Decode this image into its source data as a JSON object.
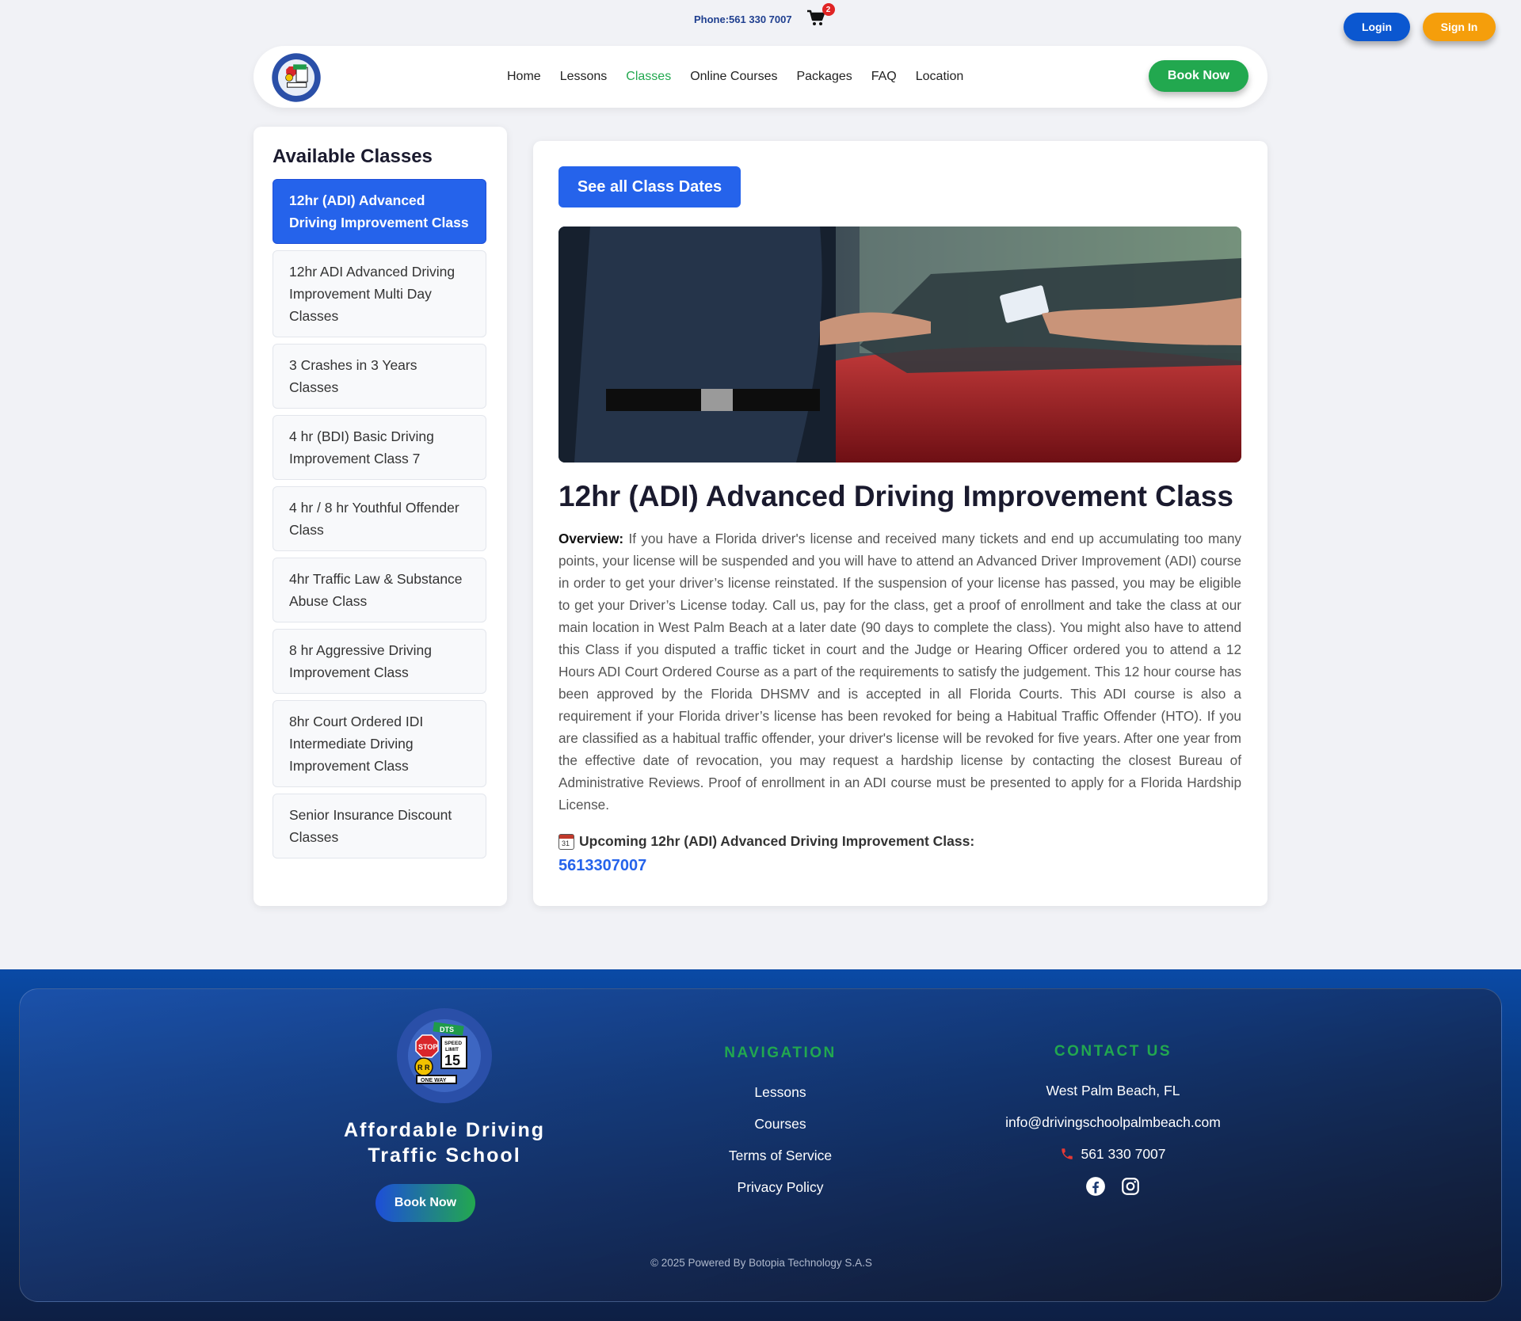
{
  "topbar": {
    "phone": "Phone:561 330 7007",
    "cart_count": "2",
    "login_label": "Login",
    "signin_label": "Sign In"
  },
  "nav": {
    "items": [
      {
        "label": "Home",
        "active": false
      },
      {
        "label": "Lessons",
        "active": false
      },
      {
        "label": "Classes",
        "active": true
      },
      {
        "label": "Online Courses",
        "active": false
      },
      {
        "label": "Packages",
        "active": false
      },
      {
        "label": "FAQ",
        "active": false
      },
      {
        "label": "Location",
        "active": false
      }
    ],
    "book_now": "Book Now"
  },
  "sidebar": {
    "title": "Available Classes",
    "items": [
      "12hr (ADI) Advanced Driving Improvement Class",
      "12hr ADI Advanced Driving Improvement Multi Day Classes",
      "3 Crashes in 3 Years Classes",
      "4 hr (BDI) Basic Driving Improvement Class 7",
      "4 hr / 8 hr Youthful Offender Class",
      "4hr Traffic Law & Substance Abuse Class",
      "8 hr Aggressive Driving Improvement Class",
      "8hr Court Ordered IDI Intermediate Driving Improvement Class",
      "Senior Insurance Discount Classes"
    ],
    "active_index": 0
  },
  "main": {
    "see_dates": "See all Class Dates",
    "title": "12hr (ADI) Advanced Driving Improvement Class",
    "overview_label": "Overview:",
    "overview_text": " If you have a Florida driver's license and received many tickets and end up accumulating too many points, your license will be suspended and you will have to attend an Advanced Driver Improvement (ADI) course in order to get your driver’s license reinstated. If the suspension of your license has passed, you may be eligible to get your Driver’s License today. Call us, pay for the class, get a proof of enrollment and take the class at our main location in West Palm Beach at a later date (90 days to complete the class). You might also have to attend this Class if you disputed a traffic ticket in court and the Judge or Hearing Officer ordered you to attend a 12 Hours ADI Court Ordered Course as a part of the requirements to satisfy the judgement. This 12 hour course has been approved by the Florida DHSMV and is accepted in all Florida Courts. This ADI course is also a requirement if your Florida driver’s license has been revoked for being a Habitual Traffic Offender (HTO). If you are classified as a habitual traffic offender, your driver's license will be revoked for five years. After one year from the effective date of revocation, you may request a hardship license by contacting the closest Bureau of Administrative Reviews. Proof of enrollment in an ADI course must be presented to apply for a Florida Hardship License.",
    "upcoming_label": "Upcoming 12hr (ADI) Advanced Driving Improvement Class:",
    "calendar_day": "31",
    "phone_link": "5613307007"
  },
  "footer": {
    "brand_line1": "Affordable Driving",
    "brand_line2": "Traffic School",
    "book_now": "Book Now",
    "nav_heading": "NAVIGATION",
    "nav_links": [
      "Lessons",
      "Courses",
      "Terms of Service",
      "Privacy Policy"
    ],
    "contact_heading": "CONTACT US",
    "address": "West Palm Beach, FL",
    "email": "info@drivingschoolpalmbeach.com",
    "phone": "561 330 7007",
    "copyright": "© 2025 Powered By Botopia Technology S.A.S"
  },
  "logo_text": {
    "ring_top": "Affordable Driving",
    "ring_bottom": "Traffic School",
    "dts": "DTS",
    "stop": "STOP",
    "speed": "SPEED",
    "limit": "LIMIT",
    "speed_value": "15",
    "rr": "R R",
    "one_way": "ONE WAY"
  },
  "colors": {
    "primary_blue": "#2563eb",
    "brand_green": "#22a84f",
    "signin_orange": "#f59e0b",
    "login_blue": "#0b57d0"
  },
  "icons": {
    "cart": "cart-icon",
    "calendar": "calendar-icon",
    "phone": "phone-icon",
    "facebook": "facebook-icon",
    "instagram": "instagram-icon"
  }
}
